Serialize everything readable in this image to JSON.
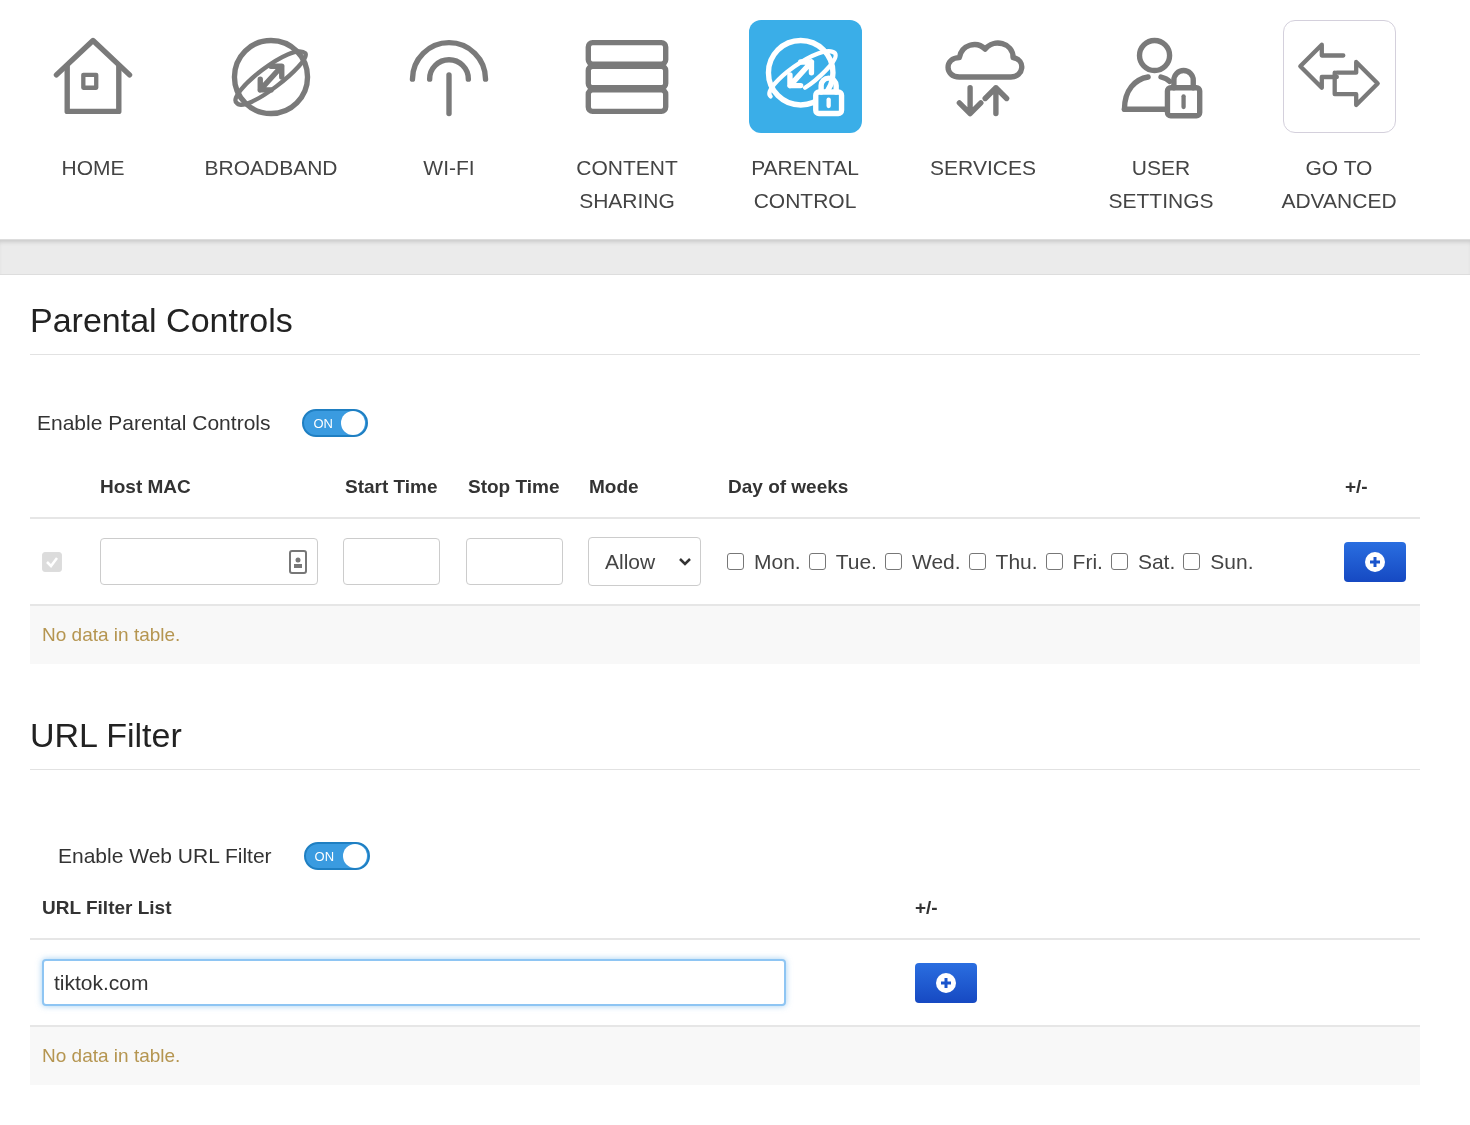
{
  "nav": [
    {
      "label": "HOME",
      "selected": false
    },
    {
      "label": "BROADBAND",
      "selected": false
    },
    {
      "label": "WI-FI",
      "selected": false
    },
    {
      "label": "CONTENT SHARING",
      "selected": false
    },
    {
      "label": "PARENTAL CONTROL",
      "selected": true
    },
    {
      "label": "SERVICES",
      "selected": false
    },
    {
      "label": "USER SETTINGS",
      "selected": false
    },
    {
      "label": "GO TO ADVANCED",
      "selected": false,
      "kind": "outlined"
    }
  ],
  "parental": {
    "title": "Parental Controls",
    "toggle": {
      "label": "Enable Parental Controls",
      "on": true,
      "text": "ON"
    },
    "columns": [
      "Host MAC",
      "Start Time",
      "Stop Time",
      "Mode",
      "Day of weeks",
      "+/-"
    ],
    "row": {
      "checked": true,
      "mode": "Allow",
      "days": [
        {
          "label": "Mon.",
          "checked": false
        },
        {
          "label": "Tue.",
          "checked": false
        },
        {
          "label": "Wed.",
          "checked": false
        },
        {
          "label": "Thu.",
          "checked": false
        },
        {
          "label": "Fri.",
          "checked": false
        },
        {
          "label": "Sat.",
          "checked": false
        },
        {
          "label": "Sun.",
          "checked": false
        }
      ]
    },
    "empty": "No data in table."
  },
  "url_filter": {
    "title": "URL Filter",
    "toggle": {
      "label": "Enable Web URL Filter",
      "on": true,
      "text": "ON"
    },
    "columns": [
      "URL Filter List",
      "+/-"
    ],
    "value": "tiktok.com",
    "empty": "No data in table."
  }
}
